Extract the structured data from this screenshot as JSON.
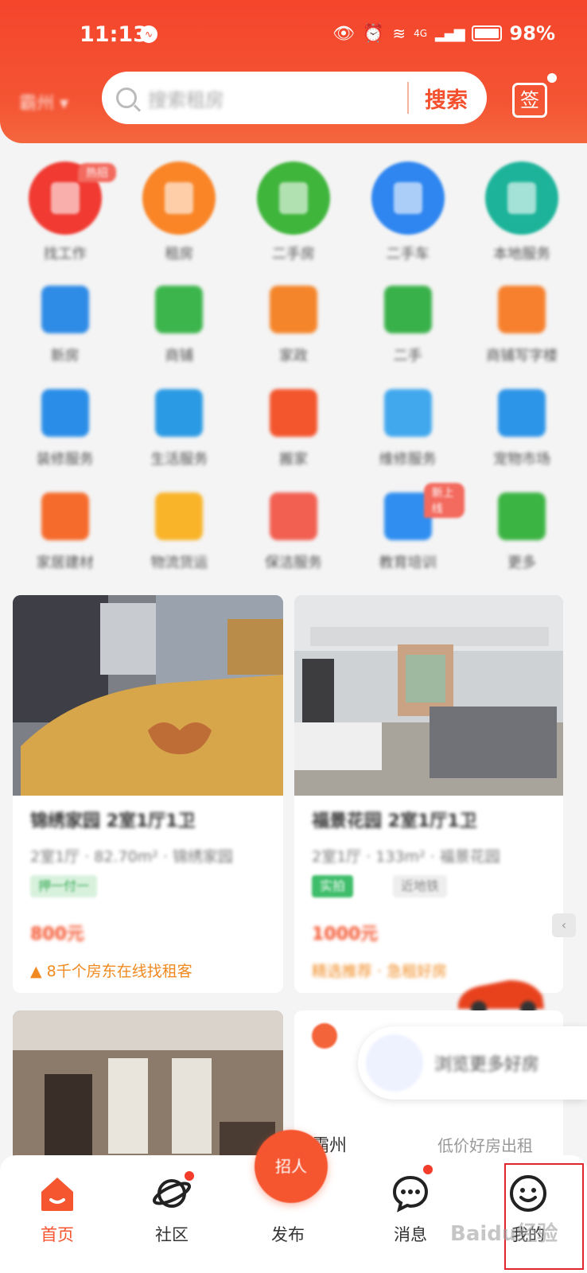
{
  "status_bar": {
    "time": "11:13",
    "network": "4G",
    "battery": "98%"
  },
  "header": {
    "city": "霸州 ▾",
    "search_placeholder": "搜索租房",
    "search_button": "搜索",
    "checkin_icon_text": "签"
  },
  "categories": [
    {
      "label": "找工作",
      "color": "#f03a32",
      "badge": "热招"
    },
    {
      "label": "租房",
      "color": "#f98527"
    },
    {
      "label": "二手房",
      "color": "#3fb53c"
    },
    {
      "label": "二手车",
      "color": "#2f86f0"
    },
    {
      "label": "本地服务",
      "color": "#1db39a"
    },
    {
      "label": "新房",
      "color": "#2e8be6"
    },
    {
      "label": "商铺",
      "color": "#3cb54c"
    },
    {
      "label": "家政",
      "color": "#f5852a"
    },
    {
      "label": "二手",
      "color": "#39b14a"
    },
    {
      "label": "商铺写字楼",
      "color": "#f6802e"
    },
    {
      "label": "装修服务",
      "color": "#2a8ee8"
    },
    {
      "label": "生活服务",
      "color": "#2b9ae4"
    },
    {
      "label": "搬家",
      "color": "#f3552d"
    },
    {
      "label": "维修服务",
      "color": "#41a8ee"
    },
    {
      "label": "宠物市场",
      "color": "#2d95e8"
    },
    {
      "label": "家居建材",
      "color": "#f56b2b"
    },
    {
      "label": "物流货运",
      "color": "#f9b42a"
    },
    {
      "label": "保洁服务",
      "color": "#f26052"
    },
    {
      "label": "教育培训",
      "color": "#2f8ef0",
      "badge": "新上线"
    },
    {
      "label": "更多",
      "color": "#3cb444"
    }
  ],
  "listings": [
    {
      "title": "锦绣家园 2室1厅1卫",
      "sub": "2室1厅 · 82.70m² · 锦绣家园",
      "tags": [
        "押一付一"
      ],
      "price": "800元",
      "note": "8千个房东在线找租客"
    },
    {
      "title": "福景花园 2室1厅1卫",
      "sub": "2室1厅 · 133m² · 福景花园",
      "tags": [
        "实拍",
        "近地铁"
      ],
      "price": "1000元",
      "note": "精选推荐 · 急租好房"
    },
    {
      "title": "",
      "sub": "",
      "tags": [],
      "price": "",
      "note": ""
    },
    {
      "title": "霸州",
      "sub": "低价好房出租",
      "tags": [],
      "price": "",
      "note": ""
    }
  ],
  "popup": {
    "text": "浏览更多好房"
  },
  "tabbar": {
    "publish": "招人",
    "tabs": [
      {
        "label": "首页",
        "active": true
      },
      {
        "label": "社区",
        "dot": true
      },
      {
        "label": "发布"
      },
      {
        "label": "消息",
        "dot": true
      },
      {
        "label": "我的"
      }
    ]
  },
  "watermark": "Baidu经验",
  "colors": {
    "brand": "#f5452c",
    "accent_orange": "#f4552f"
  }
}
